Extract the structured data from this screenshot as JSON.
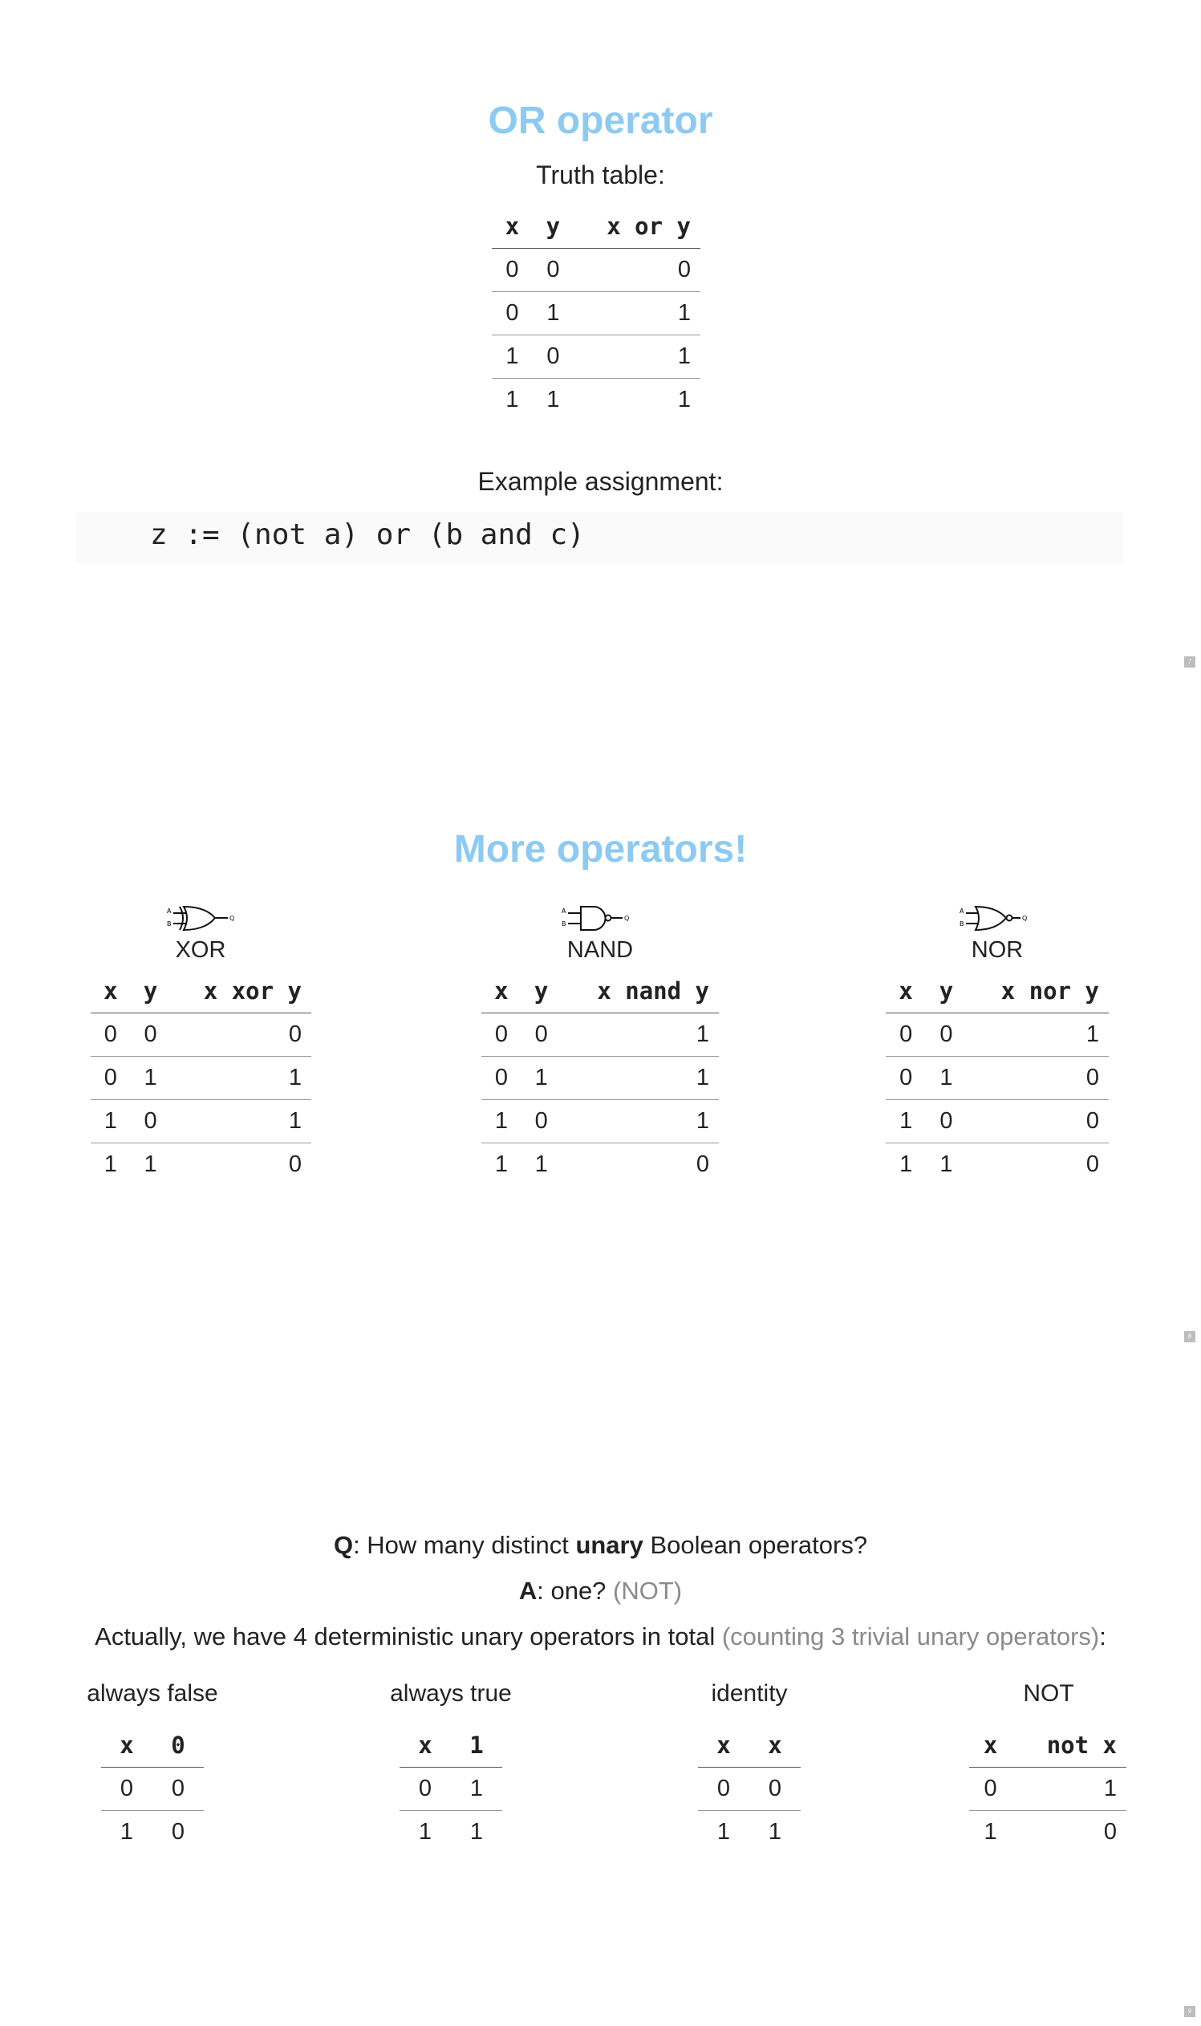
{
  "slide1": {
    "title": "OR operator",
    "truth_table_label": "Truth table:",
    "table": {
      "headers": [
        "x",
        "y",
        "x or y"
      ],
      "rows": [
        [
          "0",
          "0",
          "0"
        ],
        [
          "0",
          "1",
          "1"
        ],
        [
          "1",
          "0",
          "1"
        ],
        [
          "1",
          "1",
          "1"
        ]
      ]
    },
    "example_label": "Example assignment:",
    "code": "z := (not a) or (b and c)",
    "page_number": "7"
  },
  "slide2": {
    "title": "More operators!",
    "gates": [
      {
        "name": "XOR",
        "icon": "xor-gate-icon",
        "headers": [
          "x",
          "y",
          "x xor y"
        ],
        "rows": [
          [
            "0",
            "0",
            "0"
          ],
          [
            "0",
            "1",
            "1"
          ],
          [
            "1",
            "0",
            "1"
          ],
          [
            "1",
            "1",
            "0"
          ]
        ]
      },
      {
        "name": "NAND",
        "icon": "nand-gate-icon",
        "headers": [
          "x",
          "y",
          "x nand y"
        ],
        "rows": [
          [
            "0",
            "0",
            "1"
          ],
          [
            "0",
            "1",
            "1"
          ],
          [
            "1",
            "0",
            "1"
          ],
          [
            "1",
            "1",
            "0"
          ]
        ]
      },
      {
        "name": "NOR",
        "icon": "nor-gate-icon",
        "headers": [
          "x",
          "y",
          "x nor y"
        ],
        "rows": [
          [
            "0",
            "0",
            "1"
          ],
          [
            "0",
            "1",
            "0"
          ],
          [
            "1",
            "0",
            "0"
          ],
          [
            "1",
            "1",
            "0"
          ]
        ]
      }
    ],
    "gate_pins": {
      "a": "A",
      "b": "B",
      "q": "Q"
    },
    "page_number": "8"
  },
  "slide3": {
    "question": {
      "prefix": "Q",
      "text1": ": How many distinct ",
      "bold": "unary",
      "text2": " Boolean operators?"
    },
    "answer": {
      "prefix": "A",
      "text": ": one? ",
      "grey": "(NOT)"
    },
    "actually": {
      "text": "Actually, we have 4 deterministic unary operators in total ",
      "grey": "(counting 3 trivial unary operators)",
      "colon": ":"
    },
    "unary": [
      {
        "label": "always false",
        "headers": [
          "x",
          "0"
        ],
        "rows": [
          [
            "0",
            "0"
          ],
          [
            "1",
            "0"
          ]
        ]
      },
      {
        "label": "always true",
        "headers": [
          "x",
          "1"
        ],
        "rows": [
          [
            "0",
            "1"
          ],
          [
            "1",
            "1"
          ]
        ]
      },
      {
        "label": "identity",
        "headers": [
          "x",
          "x"
        ],
        "rows": [
          [
            "0",
            "0"
          ],
          [
            "1",
            "1"
          ]
        ]
      },
      {
        "label": "NOT",
        "headers": [
          "x",
          "not x"
        ],
        "rows": [
          [
            "0",
            "1"
          ],
          [
            "1",
            "0"
          ]
        ]
      }
    ],
    "page_number": "9"
  },
  "colors": {
    "title": "#8ccaf2",
    "text": "#222222",
    "grey": "#8a8a8a"
  }
}
